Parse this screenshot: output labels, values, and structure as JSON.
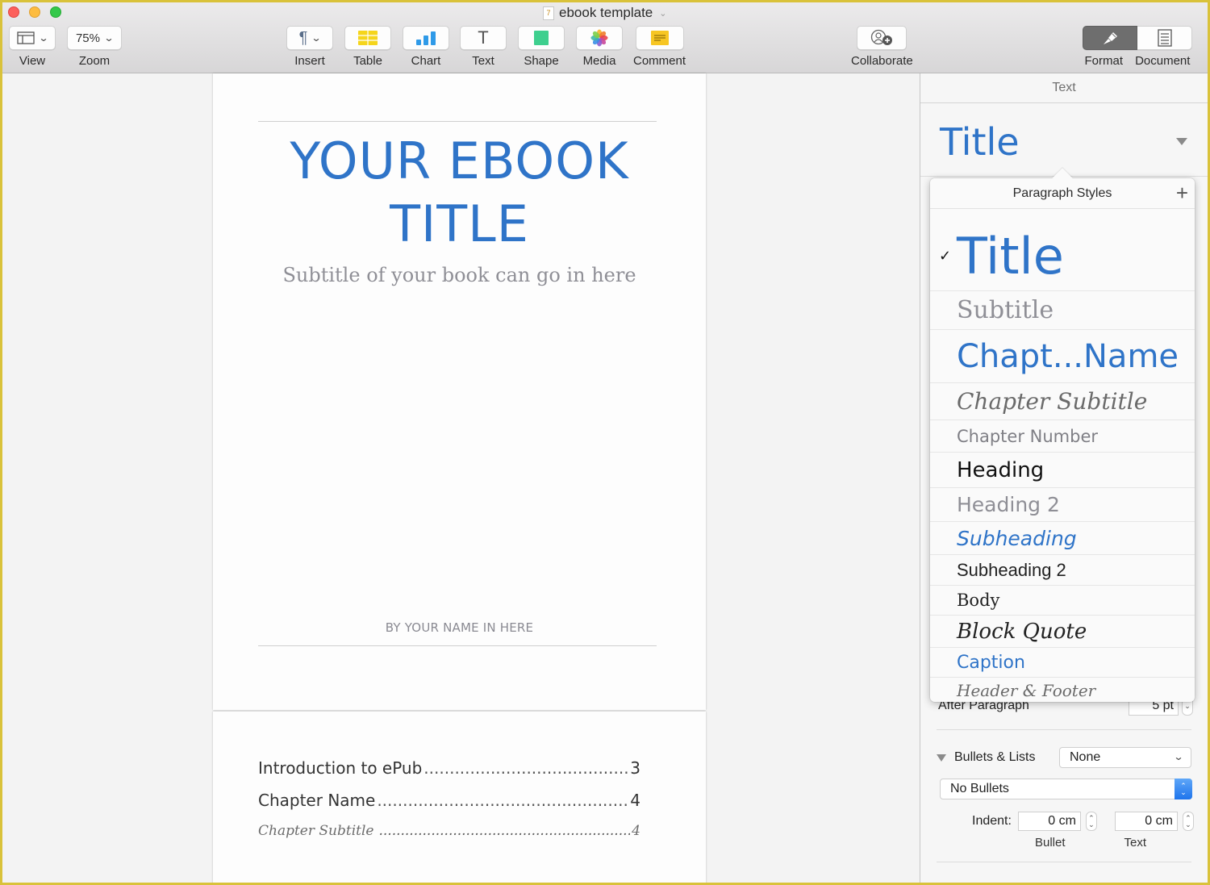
{
  "window": {
    "title": "ebook template",
    "doc_icon_glyph": "7"
  },
  "toolbar": {
    "view": {
      "label": "View",
      "icon": "sidebar-layout-icon"
    },
    "zoom": {
      "label": "Zoom",
      "value": "75%"
    },
    "insert": {
      "label": "Insert",
      "icon": "pilcrow-icon",
      "glyph": "¶"
    },
    "table": {
      "label": "Table",
      "icon": "table-icon",
      "color": "#f5d51c"
    },
    "chart": {
      "label": "Chart",
      "icon": "bar-chart-icon",
      "color": "#2f9ae8"
    },
    "text": {
      "label": "Text",
      "icon": "text-icon",
      "glyph": "T"
    },
    "shape": {
      "label": "Shape",
      "icon": "square-shape-icon",
      "color": "#3ecf8e"
    },
    "media": {
      "label": "Media",
      "icon": "photos-flower-icon"
    },
    "comment": {
      "label": "Comment",
      "icon": "sticky-note-icon",
      "color": "#f7c623"
    },
    "collaborate": {
      "label": "Collaborate",
      "icon": "add-person-icon"
    },
    "format": {
      "label": "Format",
      "icon": "paintbrush-icon",
      "active": true
    },
    "document": {
      "label": "Document",
      "icon": "document-icon"
    }
  },
  "document": {
    "page1": {
      "title": "YOUR EBOOK TITLE",
      "subtitle": "Subtitle of your book can go in here",
      "byline": "BY YOUR NAME IN HERE"
    },
    "toc": [
      {
        "label": "Introduction to ePub",
        "page": "3",
        "style": "main"
      },
      {
        "label": "Chapter Name",
        "page": "4",
        "style": "main"
      },
      {
        "label": "Chapter Subtitle",
        "page": "4",
        "style": "sub"
      }
    ]
  },
  "sidebar": {
    "tab": "Text",
    "current_style": "Title",
    "after_paragraph": {
      "label": "After Paragraph",
      "value": "5 pt"
    },
    "bullets": {
      "label": "Bullets & Lists",
      "type_value": "None",
      "bullet_style": "No Bullets",
      "indent_label": "Indent:",
      "bullet_indent": "0 cm",
      "text_indent": "0 cm",
      "bullet_caption": "Bullet",
      "text_caption": "Text"
    }
  },
  "paragraph_styles": {
    "header": "Paragraph Styles",
    "add_glyph": "+",
    "check_glyph": "✓",
    "selected": "Title",
    "items": [
      "Title",
      "Subtitle",
      "Chapt...Name",
      "Chapter Subtitle",
      "Chapter Number",
      "Heading",
      "Heading 2",
      "Subheading",
      "Subheading 2",
      "Body",
      "Block Quote",
      "Caption",
      "Header & Footer"
    ]
  },
  "colors": {
    "accent_blue": "#2f74c8",
    "subtitle_gray": "#8f8f96",
    "window_frame": "#d9c23a"
  }
}
